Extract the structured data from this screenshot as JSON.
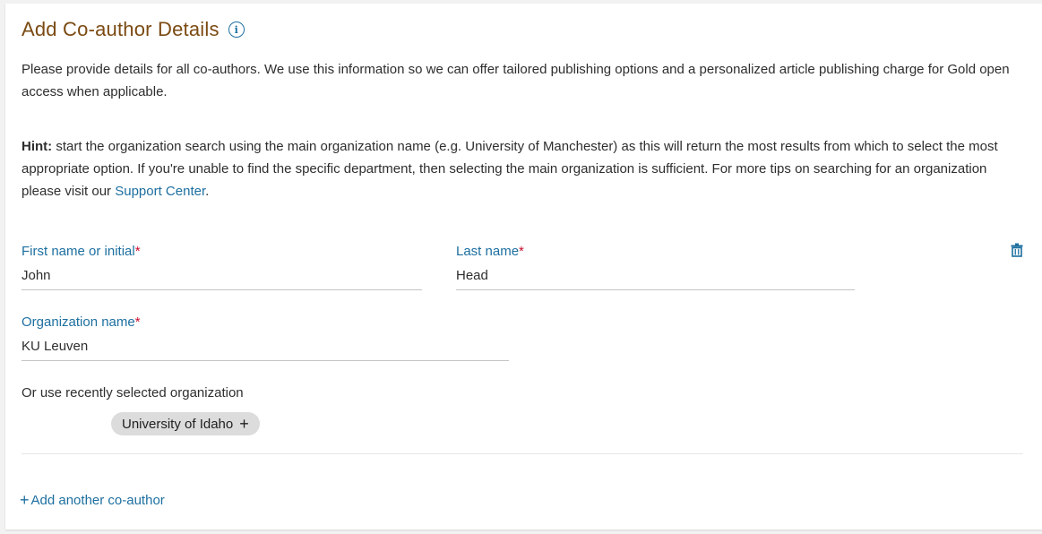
{
  "header": {
    "title": "Add Co-author Details",
    "info_icon": "info-icon"
  },
  "intro": {
    "text": "Please provide details for all co-authors. We use this information so we can offer tailored publishing options and a personalized article publishing charge for Gold open access when applicable."
  },
  "hint": {
    "label": "Hint:",
    "text": " start the organization search using the main organization name (e.g. University of Manchester) as this will return the most results from which to select the most appropriate option. If you're unable to find the specific department, then selecting the main organization is sufficient. For more tips on searching for an organization please visit our ",
    "link": "Support Center",
    "end": "."
  },
  "form": {
    "first_name": {
      "label": "First name or initial",
      "required_mark": "*",
      "value": "John"
    },
    "last_name": {
      "label": "Last name",
      "required_mark": "*",
      "value": "Head"
    },
    "organization": {
      "label": "Organization name",
      "required_mark": "*",
      "value": "KU Leuven"
    },
    "delete_icon": "trash-icon"
  },
  "recent": {
    "label": "Or use recently selected organization",
    "chip": "University of Idaho",
    "chip_icon": "+"
  },
  "actions": {
    "add_icon": "+",
    "add_label": "Add another co-author"
  },
  "colors": {
    "title": "#7b4a12",
    "link": "#1d6fa0",
    "required": "#c8102e",
    "chip_bg": "#dcdcdc"
  }
}
